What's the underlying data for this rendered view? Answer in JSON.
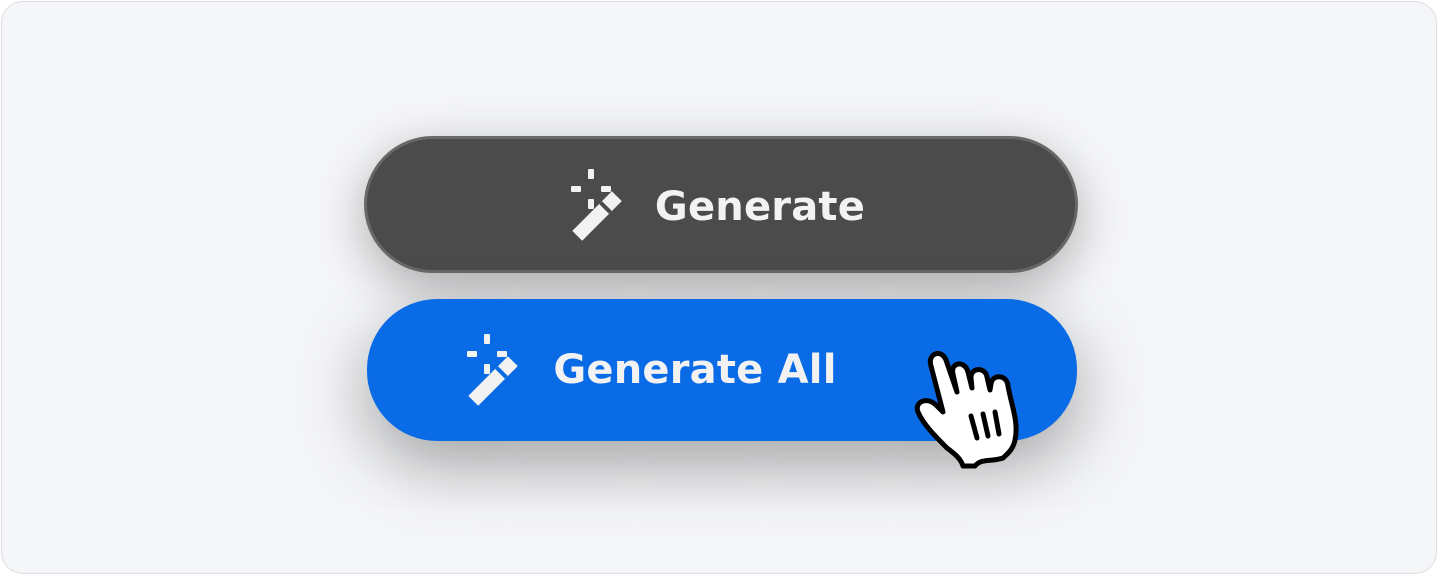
{
  "buttons": {
    "generate": {
      "label": "Generate",
      "icon": "magic-wand-icon",
      "background": "#4b4b4b"
    },
    "generate_all": {
      "label": "Generate All",
      "icon": "magic-wand-icon",
      "background": "#096be6"
    }
  },
  "cursor": {
    "icon": "pointer-hand-icon"
  }
}
